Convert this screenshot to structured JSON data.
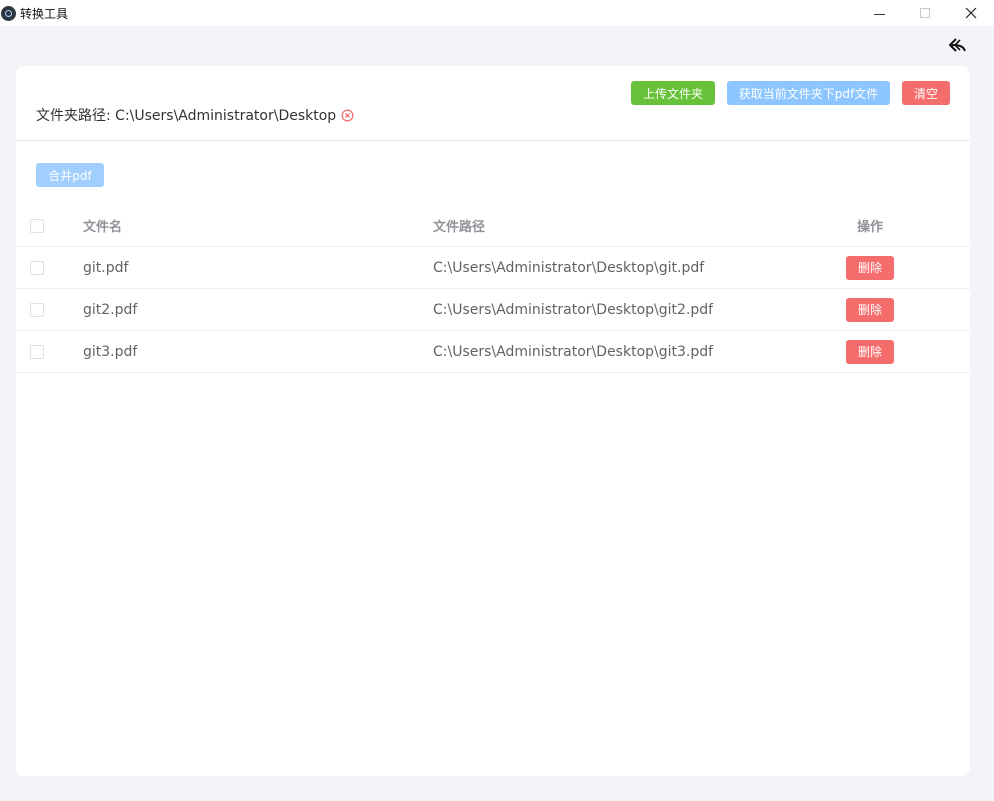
{
  "window": {
    "title": "转换工具"
  },
  "header": {
    "path_label": "文件夹路径: C:\\Users\\Administrator\\Desktop",
    "upload_label": "上传文件夹",
    "fetch_label": "获取当前文件夹下pdf文件",
    "clear_label": "清空"
  },
  "toolbar": {
    "merge_label": "合并pdf"
  },
  "table": {
    "columns": {
      "name": "文件名",
      "path": "文件路径",
      "action": "操作"
    },
    "rows": [
      {
        "name": "git.pdf",
        "path": "C:\\Users\\Administrator\\Desktop\\git.pdf",
        "action": "删除"
      },
      {
        "name": "git2.pdf",
        "path": "C:\\Users\\Administrator\\Desktop\\git2.pdf",
        "action": "删除"
      },
      {
        "name": "git3.pdf",
        "path": "C:\\Users\\Administrator\\Desktop\\git3.pdf",
        "action": "删除"
      }
    ]
  },
  "colors": {
    "success": "#67c23a",
    "primary_light": "#8cc5ff",
    "danger": "#f56c6c",
    "background": "#f2f4f7"
  },
  "icons": {
    "app": "app-logo-icon",
    "minimize": "minimize-icon",
    "maximize": "maximize-icon",
    "close": "close-icon",
    "back": "back-arrow-icon",
    "clear_path": "clear-circle-icon"
  }
}
